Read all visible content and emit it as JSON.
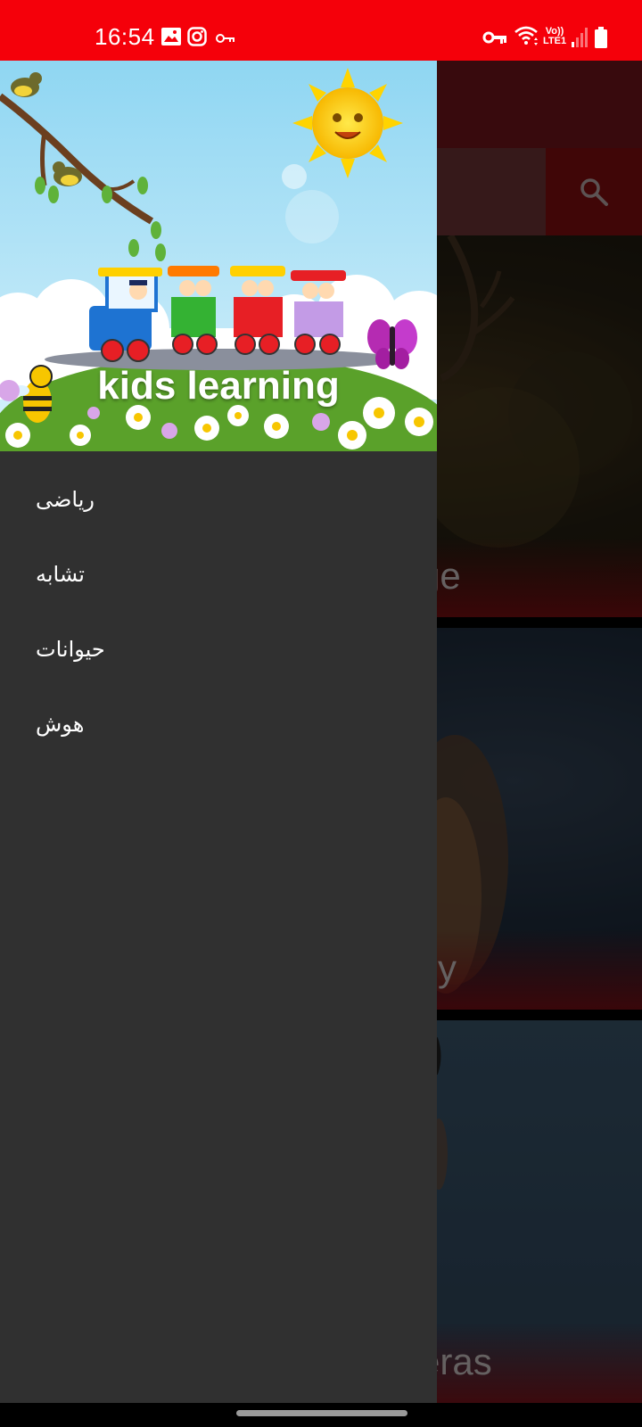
{
  "status_bar": {
    "time": "16:54",
    "network_label_top": "Vo))",
    "network_label_bottom": "LTE1",
    "left_icons": [
      "gallery-icon",
      "instagram-icon",
      "key-icon"
    ],
    "right_icons": [
      "vpn-key-icon",
      "wifi-icon",
      "signal-icon",
      "battery-icon"
    ]
  },
  "main": {
    "cards": [
      {
        "title": "ge"
      },
      {
        "title": "sy"
      },
      {
        "title": "eras"
      }
    ]
  },
  "drawer": {
    "header": {
      "title": "kids learning"
    },
    "items": [
      {
        "label": "ریاضی"
      },
      {
        "label": "تشابه"
      },
      {
        "label": "حیوانات"
      },
      {
        "label": "هوش"
      }
    ]
  },
  "colors": {
    "status_bar": "#f5000a",
    "drawer_bg": "#303030",
    "app_bar": "#5e1216",
    "accent": "#6b0a0d"
  }
}
